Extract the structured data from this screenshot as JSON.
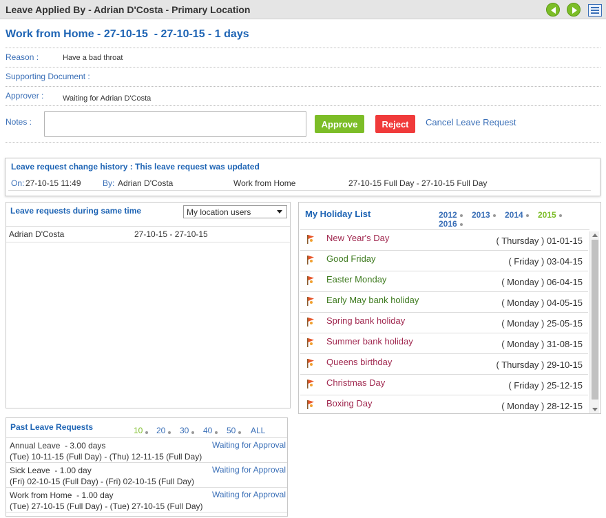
{
  "header": {
    "title": "Leave Applied By - Adrian D'Costa - Primary Location"
  },
  "leave": {
    "heading": "Work from Home - 27-10-15  - 27-10-15 - 1 days",
    "reason_label": "Reason :",
    "reason_value": "Have a bad throat",
    "supporting_label": "Supporting Document :",
    "approver_label": "Approver :",
    "approver_value": "Waiting for Adrian D'Costa",
    "notes_label": "Notes :",
    "notes_value": "",
    "approve_label": "Approve",
    "reject_label": "Reject",
    "cancel_label": "Cancel Leave Request"
  },
  "history": {
    "title": "Leave request change history : This leave request was updated",
    "on_label": "On:",
    "on_value": "27-10-15 11:49",
    "by_label": "By:",
    "by_value": "Adrian D'Costa",
    "type": "Work from Home",
    "range": "27-10-15 Full Day - 27-10-15 Full Day"
  },
  "same_time": {
    "title": "Leave requests during same time",
    "filter_selected": "My location users",
    "rows": [
      {
        "name": "Adrian D'Costa",
        "dates": "27-10-15 - 27-10-15"
      }
    ]
  },
  "holidays": {
    "title": "My Holiday List",
    "years": [
      "2012",
      "2013",
      "2014",
      "2015",
      "2016"
    ],
    "selected_year": "2015",
    "items": [
      {
        "name": "New Year's Day",
        "day": "( Thursday ) 01-01-15",
        "color": "#a0284f"
      },
      {
        "name": "Good Friday",
        "day": "( Friday ) 03-04-15",
        "color": "#3d7a1e"
      },
      {
        "name": "Easter Monday",
        "day": "( Monday ) 06-04-15",
        "color": "#3d7a1e"
      },
      {
        "name": "Early May bank holiday",
        "day": "( Monday ) 04-05-15",
        "color": "#3d7a1e"
      },
      {
        "name": "Spring bank holiday",
        "day": "( Monday ) 25-05-15",
        "color": "#a0284f"
      },
      {
        "name": "Summer bank holiday",
        "day": "( Monday ) 31-08-15",
        "color": "#a0284f"
      },
      {
        "name": "Queens birthday",
        "day": "( Thursday ) 29-10-15",
        "color": "#a0284f"
      },
      {
        "name": "Christmas Day",
        "day": "( Friday ) 25-12-15",
        "color": "#a0284f"
      },
      {
        "name": "Boxing Day",
        "day": "( Monday ) 28-12-15",
        "color": "#a0284f"
      }
    ]
  },
  "past": {
    "title": "Past Leave Requests",
    "page_sizes": [
      "10",
      "20",
      "30",
      "40",
      "50",
      "ALL"
    ],
    "selected_size": "10",
    "rows": [
      {
        "type": "Annual Leave  - 3.00 days",
        "range": "(Tue) 10-11-15 (Full Day) - (Thu) 12-11-15 (Full Day)",
        "status": "Waiting for Approval"
      },
      {
        "type": "Sick Leave  - 1.00 day",
        "range": "(Fri) 02-10-15 (Full Day) - (Fri) 02-10-15 (Full Day)",
        "status": "Waiting for Approval"
      },
      {
        "type": "Work from Home  - 1.00 day",
        "range": "(Tue) 27-10-15 (Full Day) - (Tue) 27-10-15 (Full Day)",
        "status": "Waiting for Approval"
      }
    ]
  }
}
